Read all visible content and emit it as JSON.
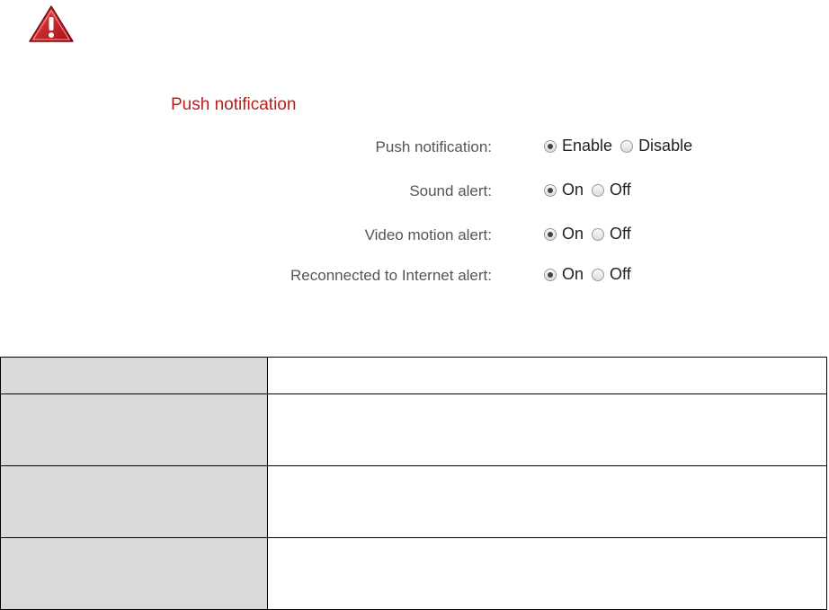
{
  "section_title": "Push notification",
  "settings": [
    {
      "label": "Push notification:",
      "options": [
        {
          "text": "Enable",
          "checked": true
        },
        {
          "text": "Disable",
          "checked": false
        }
      ]
    },
    {
      "label": "Sound alert:",
      "options": [
        {
          "text": "On",
          "checked": true
        },
        {
          "text": "Off",
          "checked": false
        }
      ]
    },
    {
      "label": "Video motion alert:",
      "options": [
        {
          "text": "On",
          "checked": true
        },
        {
          "text": "Off",
          "checked": false
        }
      ]
    },
    {
      "label": "Reconnected to Internet alert:",
      "options": [
        {
          "text": "On",
          "checked": true
        },
        {
          "text": "Off",
          "checked": false
        }
      ]
    }
  ],
  "table": {
    "rows": [
      {
        "key": "",
        "value": ""
      },
      {
        "key": "",
        "value": ""
      },
      {
        "key": "",
        "value": ""
      },
      {
        "key": "",
        "value": ""
      }
    ]
  },
  "icons": {
    "warning": "warning-triangle-icon"
  },
  "colors": {
    "title": "#b3211f",
    "warning_red": "#c8181d",
    "table_key_bg": "#d9d9d9"
  }
}
